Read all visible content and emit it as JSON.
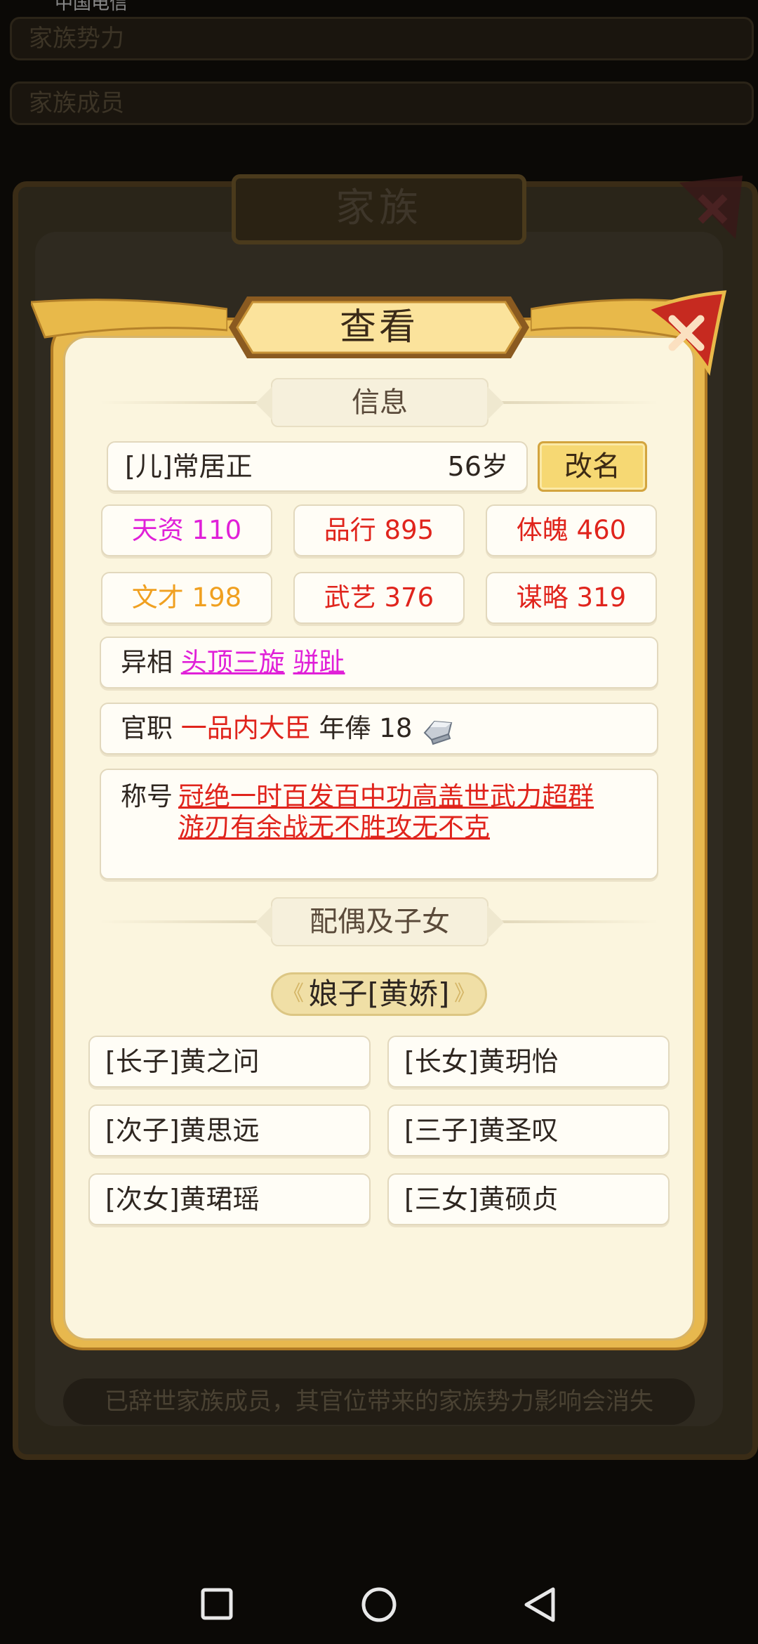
{
  "status_bar": {
    "carrier": "中国电信"
  },
  "background": {
    "rows": [
      {
        "label": "家族势力",
        "value": ""
      },
      {
        "label": "家族成员",
        "value": ""
      }
    ],
    "panel_title": "家族",
    "hint": "已辞世家族成员，其官位带来的家族势力影响会消失"
  },
  "dialog": {
    "title": "查看",
    "info_section": "信息",
    "name": "[儿]常居正",
    "age": "56岁",
    "rename_label": "改名",
    "stats": [
      {
        "label": "天资 110",
        "color": "#e020d8"
      },
      {
        "label": "品行 895",
        "color": "#e0241c"
      },
      {
        "label": "体魄 460",
        "color": "#e0241c"
      },
      {
        "label": "文才 198",
        "color": "#f0a020"
      },
      {
        "label": "武艺 376",
        "color": "#e0241c"
      },
      {
        "label": "谋略 319",
        "color": "#e0241c"
      }
    ],
    "traits": {
      "label": "异相",
      "items": [
        "头顶三旋",
        "骈趾"
      ]
    },
    "office": {
      "label": "官职",
      "title": "一品内大臣",
      "salary_label": "年俸",
      "salary": "18",
      "salary_icon": "silver-ingot-icon"
    },
    "honors": {
      "label": "称号",
      "line1": "冠绝一时百发百中功高盖世武力超群",
      "line2": "游刃有余战无不胜攻无不克"
    },
    "family_section": "配偶及子女",
    "spouse": "娘子[黄娇]",
    "children": [
      "[长子]黄之问",
      "[长女]黄玥怡",
      "[次子]黄思远",
      "[三子]黄圣叹",
      "[次女]黄珺瑶",
      "[三女]黄硕贞"
    ]
  }
}
